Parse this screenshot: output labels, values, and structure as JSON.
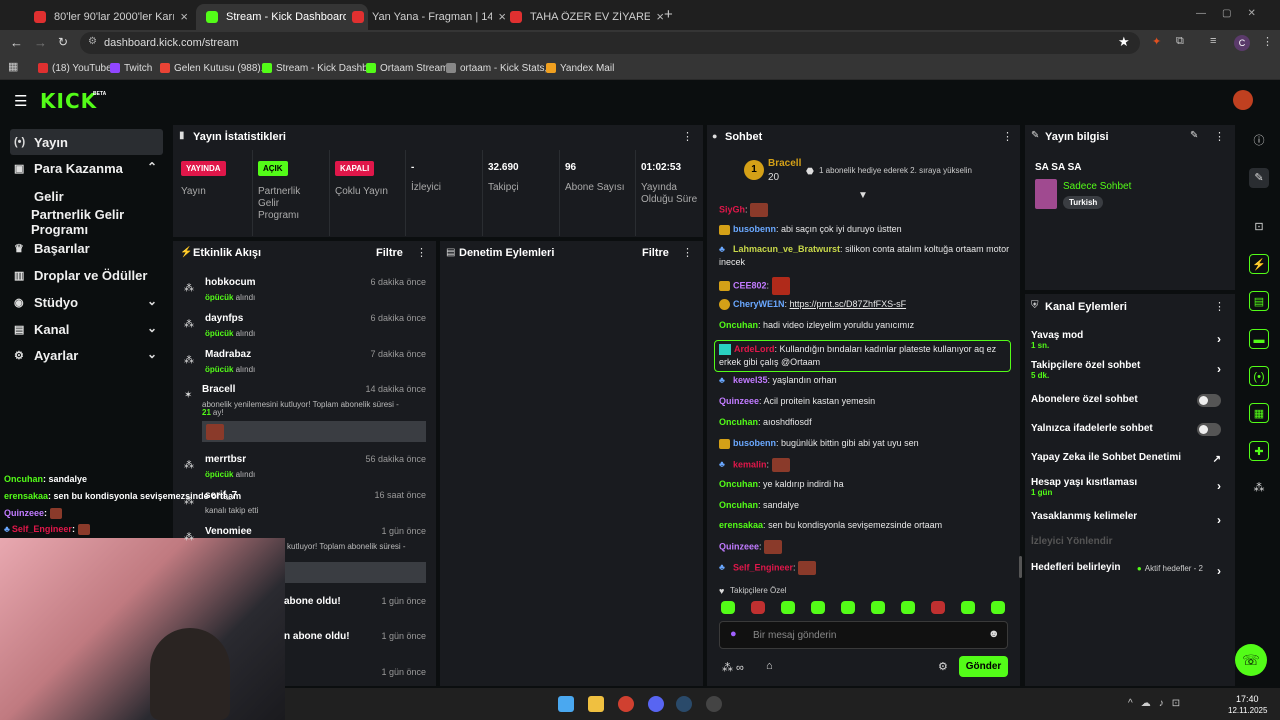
{
  "browser": {
    "tabs": [
      {
        "label": "80'ler 90'lar 2000'ler Karışık Tü",
        "color": "#e03030"
      },
      {
        "label": "Stream - Kick Dashboard",
        "color": "#53fc18"
      },
      {
        "label": "Yan Yana - Fragman | 14 Kasım",
        "color": "#e03030"
      },
      {
        "label": "TAHA ÖZER EV ZİYARETİ - YouT",
        "color": "#e03030"
      }
    ],
    "url": "dashboard.kick.com/stream",
    "profile_initial": "C",
    "bookmarks": [
      {
        "label": "(18) YouTube",
        "color": "#e03030"
      },
      {
        "label": "Twitch",
        "color": "#9146ff"
      },
      {
        "label": "Gelen Kutusu (988)...",
        "color": "#ea4335"
      },
      {
        "label": "Stream - Kick Dashb...",
        "color": "#53fc18"
      },
      {
        "label": "Ortaam Stream",
        "color": "#53fc18"
      },
      {
        "label": "ortaam - Kick Stats,...",
        "color": "#888888"
      },
      {
        "label": "Yandex Mail",
        "color": "#f0a020"
      }
    ]
  },
  "brand": {
    "logo": "KICK",
    "beta": "BETA",
    "accent": "#53fc18"
  },
  "sidebar": {
    "items": [
      {
        "label": "Yayın",
        "icon": "broadcast-icon"
      },
      {
        "label": "Para Kazanma",
        "icon": "dollar-icon"
      },
      {
        "label": "Gelir",
        "icon": ""
      },
      {
        "label": "Partnerlik Gelir Programı",
        "icon": ""
      },
      {
        "label": "Başarılar",
        "icon": "trophy-icon"
      },
      {
        "label": "Droplar ve Ödüller",
        "icon": "gift-icon"
      },
      {
        "label": "Stüdyo",
        "icon": "studio-icon"
      },
      {
        "label": "Kanal",
        "icon": "channel-icon"
      },
      {
        "label": "Ayarlar",
        "icon": "gear-icon"
      }
    ]
  },
  "stats": {
    "title": "Yayın İstatistikleri",
    "items": [
      {
        "value": "YAYINDA",
        "label": "Yayın",
        "kind": "badge",
        "color": "#e0174a"
      },
      {
        "value": "AÇIK",
        "label": "Partnerlik Gelir Programı",
        "kind": "badge",
        "color": "#53fc18"
      },
      {
        "value": "KAPALI",
        "label": "Çoklu Yayın",
        "kind": "badge",
        "color": "#e0174a"
      },
      {
        "value": "-",
        "label": "İzleyici",
        "kind": "num"
      },
      {
        "value": "32.690",
        "label": "Takipçi",
        "kind": "num"
      },
      {
        "value": "96",
        "label": "Abone Sayısı",
        "kind": "num"
      },
      {
        "value": "01:02:53",
        "label": "Yayında Olduğu Süre",
        "kind": "num"
      }
    ]
  },
  "activity": {
    "title": "Etkinlik Akışı",
    "filter": "Filtre",
    "events": [
      {
        "user": "hobkocum",
        "time": "6 dakika önce",
        "hl": "öpücük",
        "rest": " alındı"
      },
      {
        "user": "daynfps",
        "time": "6 dakika önce",
        "hl": "öpücük",
        "rest": " alındı"
      },
      {
        "user": "Madrabaz",
        "time": "7 dakika önce",
        "hl": "öpücük",
        "rest": " alındı"
      },
      {
        "user": "Bracell",
        "time": "14 dakika önce",
        "hl": "",
        "rest": "abonelik yenilemesini kutluyor! Toplam abonelik süresi -"
      },
      {
        "user": "merrtbsr",
        "time": "56 dakika önce",
        "hl": "öpücük",
        "rest": " alındı"
      },
      {
        "user": "serif_7",
        "time": "16 saat önce",
        "hl": "",
        "rest": "kanalı takip etti"
      },
      {
        "user": "Venomiee",
        "time": "1 gün önce",
        "hl": "",
        "rest": "kutluyor! Toplam abonelik süresi -"
      },
      {
        "user": "abone oldu!",
        "time": "1 gün önce",
        "hl": "",
        "rest": ""
      },
      {
        "user": "n abone oldu!",
        "time": "1 gün önce",
        "hl": "",
        "rest": ""
      },
      {
        "user": "",
        "time": "1 gün önce",
        "hl": "",
        "rest": ""
      }
    ],
    "bracell_months": "21",
    "bracell_suffix": "ay!"
  },
  "moderation": {
    "title": "Denetim Eylemleri",
    "filter": "Filtre"
  },
  "chat": {
    "title": "Sohbet",
    "pinned_user": "Bracell",
    "pinned_count": "20",
    "pinned_rank": "1",
    "pinned_text": "1 abonelik hediye ederek 2. sıraya yükselin",
    "messages": [
      {
        "user": "SiyGh",
        "color": "#e0174a",
        "text": ""
      },
      {
        "user": "busobenn",
        "color": "#6aa8ff",
        "text": "abi saçın çok iyi duruyo üstten"
      },
      {
        "user": "Lahmacun_ve_Bratwurst",
        "color": "#c8d84a",
        "text": "silikon conta atalım koltuğa ortaam motor inecek"
      },
      {
        "user": "CEE802",
        "color": "#c17bff",
        "text": ""
      },
      {
        "user": "CheryWE1N",
        "color": "#6aa8ff",
        "text": "https://prnt.sc/D87ZhfFXS-sF"
      },
      {
        "user": "Oncuhan",
        "color": "#53fc18",
        "text": "hadi video izleyelim yoruldu yanıcımız"
      },
      {
        "user": "ArdeLord",
        "color": "#e0174a",
        "text": "Kullandığın bındaları kadınlar plateste kullanıyor aq ez erkek gibi çalış @Ortaam"
      },
      {
        "user": "kewel35",
        "color": "#c17bff",
        "text": "yaşlandın orhan"
      },
      {
        "user": "Quinzeee",
        "color": "#c17bff",
        "text": "Acil proitein kastan yemesin"
      },
      {
        "user": "Oncuhan",
        "color": "#53fc18",
        "text": "aıoshdfiosdf"
      },
      {
        "user": "busobenn",
        "color": "#6aa8ff",
        "text": "bugünlük bittin gibi abi yat uyu sen"
      },
      {
        "user": "kemalin",
        "color": "#e0174a",
        "text": ""
      },
      {
        "user": "Oncuhan",
        "color": "#53fc18",
        "text": "ye kaldırıp indirdi ha"
      },
      {
        "user": "Oncuhan",
        "color": "#53fc18",
        "text": "sandalye"
      },
      {
        "user": "erensakaa",
        "color": "#53fc18",
        "text": "sen bu kondisyonla sevişemezsinde ortaam"
      },
      {
        "user": "Quinzeee",
        "color": "#c17bff",
        "text": ""
      },
      {
        "user": "Self_Engineer",
        "color": "#e0174a",
        "text": ""
      }
    ],
    "followers_label": "Takipçilere Özel",
    "input_placeholder": "Bir mesaj gönderin",
    "send_label": "Gönder"
  },
  "stream_info": {
    "title": "Yayın bilgisi",
    "stream_title": "SA SA SA",
    "category": "Sadece Sohbet",
    "tag": "Turkish"
  },
  "channel_actions": {
    "title": "Kanal Eylemleri",
    "items": [
      {
        "label": "Yavaş mod",
        "sub": "1 sn.",
        "kind": "arrow"
      },
      {
        "label": "Takipçilere özel sohbet",
        "sub": "5 dk.",
        "kind": "arrow"
      },
      {
        "label": "Abonelere özel sohbet",
        "sub": "",
        "kind": "toggle"
      },
      {
        "label": "Yalnızca ifadelerle sohbet",
        "sub": "",
        "kind": "toggle"
      },
      {
        "label": "Yapay Zeka ile Sohbet Denetimi",
        "sub": "",
        "kind": "ext"
      },
      {
        "label": "Hesap yaşı kısıtlaması",
        "sub": "1 gün",
        "kind": "arrow"
      },
      {
        "label": "Yasaklanmış kelimeler",
        "sub": "",
        "kind": "arrow"
      },
      {
        "label": "İzleyici Yönlendir",
        "sub": "",
        "kind": "disabled"
      },
      {
        "label": "Hedefleri belirleyin",
        "sub": "",
        "kind": "goal"
      }
    ],
    "goal_status": "Aktif hedefler - 2"
  },
  "overlay_chat": [
    {
      "user": "Oncuhan",
      "color": "#53fc18",
      "text": ": sandalye"
    },
    {
      "user": "erensakaa",
      "color": "#53fc18",
      "text": ": sen bu kondisyonla sevişemezsinde ortaam"
    },
    {
      "user": "Quinzeee",
      "color": "#c17bff",
      "text": ":"
    },
    {
      "user": "Self_Engineer",
      "color": "#e0174a",
      "text": ":"
    }
  ],
  "taskbar": {
    "time": "17:40",
    "date": "12.11.2025"
  }
}
